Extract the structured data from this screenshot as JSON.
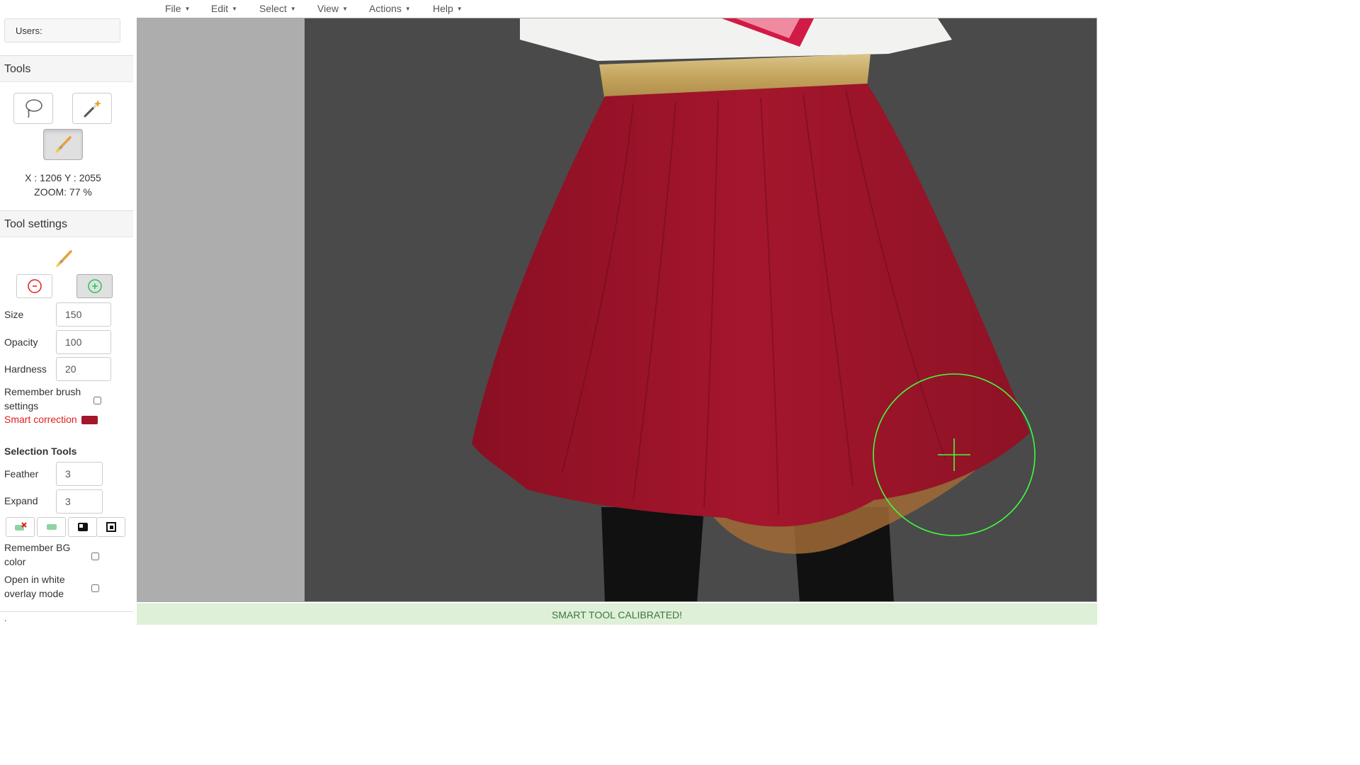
{
  "menu": {
    "items": [
      {
        "label": "File"
      },
      {
        "label": "Edit"
      },
      {
        "label": "Select"
      },
      {
        "label": "View"
      },
      {
        "label": "Actions"
      },
      {
        "label": "Help"
      }
    ]
  },
  "sidebar": {
    "users_label": "Users:",
    "tools_title": "Tools",
    "tools": [
      {
        "name": "lasso-tool",
        "icon": "lasso-icon",
        "active": false
      },
      {
        "name": "magic-wand-tool",
        "icon": "magic-wand-icon",
        "active": false
      },
      {
        "name": "brush-tool",
        "icon": "brush-icon",
        "active": true
      }
    ],
    "coords_text": "X : 1206 Y : 2055",
    "zoom_text": "ZOOM: 77 %",
    "tool_settings_title": "Tool settings",
    "brush_modes": [
      {
        "icon": "minus-circle-icon",
        "active": false
      },
      {
        "icon": "plus-circle-icon",
        "active": true
      }
    ],
    "size_label": "Size",
    "size_value": "150",
    "opacity_label": "Opacity",
    "opacity_value": "100",
    "hardness_label": "Hardness",
    "hardness_value": "20",
    "remember_brush_line1": "Remember brush",
    "remember_brush_line2": "settings",
    "smart_correction_label": "Smart correction",
    "smart_correction_color": "#a3162c",
    "selection_tools_title": "Selection Tools",
    "feather_label": "Feather",
    "feather_value": "3",
    "expand_label": "Expand",
    "expand_value": "3",
    "bg_buttons": [
      "clear-bg-icon",
      "green-bg-icon",
      "black-white-bg-icon",
      "crop-frame-icon"
    ],
    "remember_bg_line1": "Remember BG",
    "remember_bg_line2": "color",
    "white_overlay_line1": "Open in white",
    "white_overlay_line2": "overlay mode",
    "bottom_text": "."
  },
  "status": {
    "message": "SMART TOOL CALIBRATED!"
  },
  "colors": {
    "accent_green": "#3cff3c",
    "status_bg": "#dff0d8",
    "status_text": "#3c763d",
    "workspace_bg": "#4a4a4a"
  }
}
